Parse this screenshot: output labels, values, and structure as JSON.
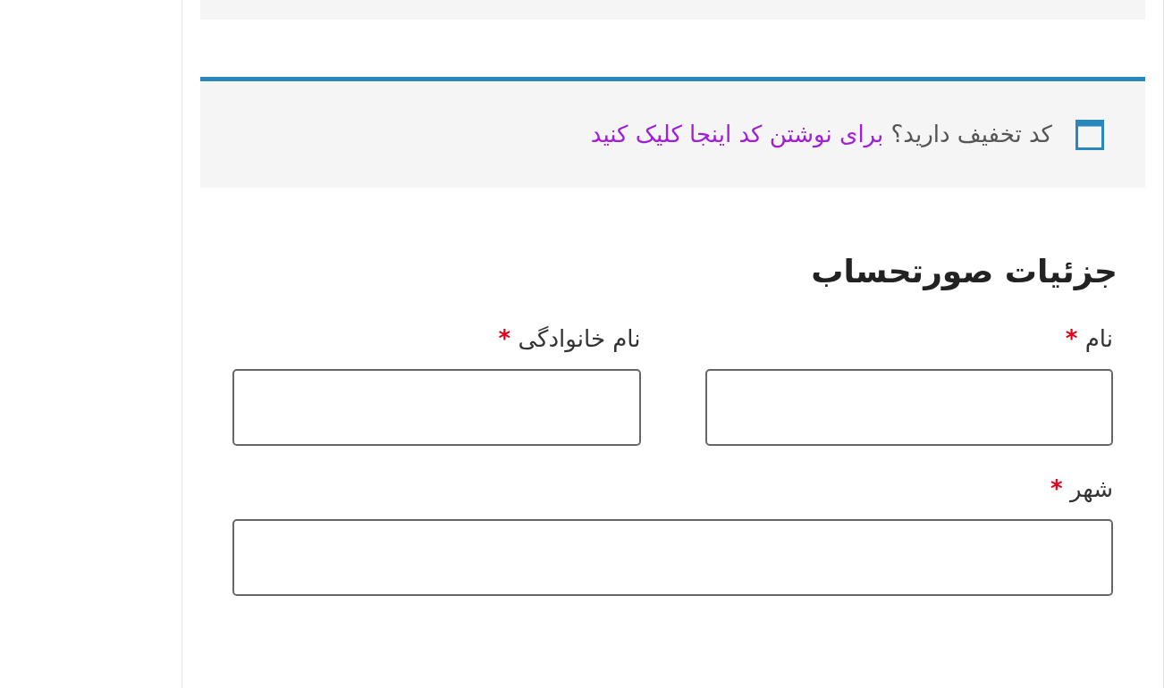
{
  "coupon_notice": {
    "question": "کد تخفیف دارید؟",
    "link": "برای نوشتن کد اینجا کلیک کنید"
  },
  "billing": {
    "heading": "جزئیات صورتحساب",
    "rows": [
      [
        {
          "label": "نام",
          "required_mark": "*"
        },
        {
          "label": "نام خانوادگی",
          "required_mark": "*"
        }
      ],
      [
        {
          "label": "شهر",
          "required_mark": "*"
        }
      ]
    ]
  }
}
